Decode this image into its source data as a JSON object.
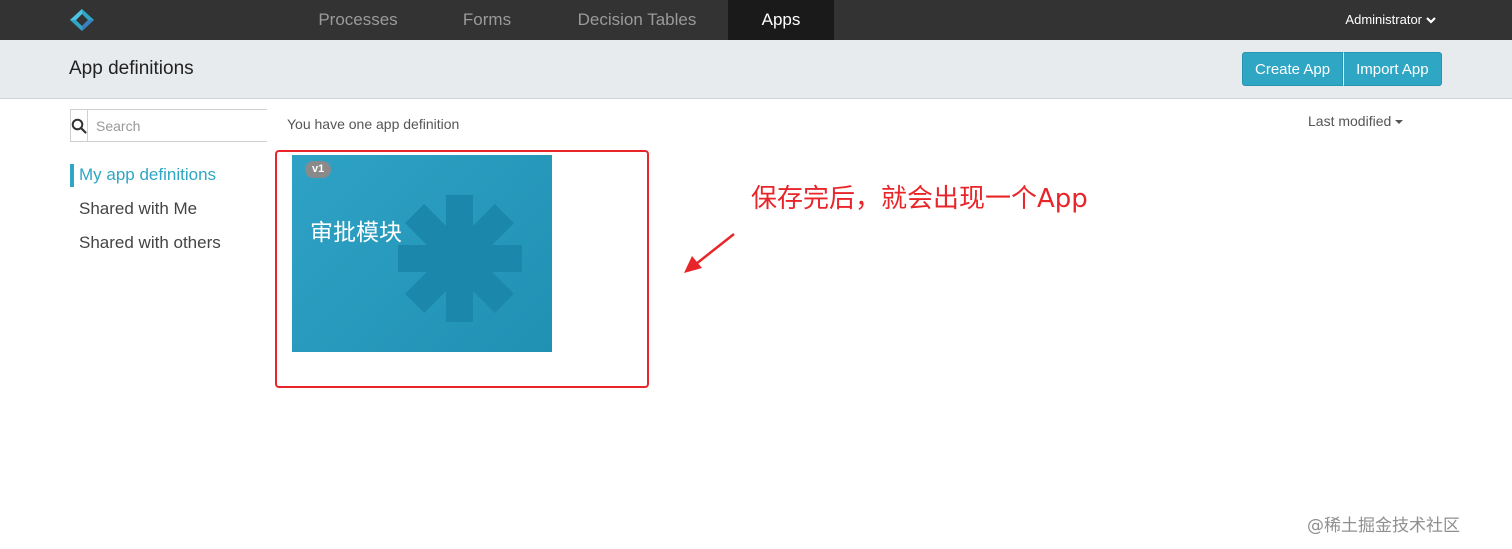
{
  "nav": {
    "items": [
      {
        "label": "Processes"
      },
      {
        "label": "Forms"
      },
      {
        "label": "Decision Tables"
      },
      {
        "label": "Apps"
      }
    ],
    "user": "Administrator"
  },
  "header": {
    "title": "App definitions",
    "create_label": "Create App",
    "import_label": "Import App"
  },
  "search": {
    "placeholder": "Search",
    "value": ""
  },
  "sidebar": {
    "items": [
      {
        "label": "My app definitions"
      },
      {
        "label": "Shared with Me"
      },
      {
        "label": "Shared with others"
      }
    ]
  },
  "main": {
    "summary": "You have one app definition",
    "sort_label": "Last modified",
    "apps": [
      {
        "version": "v1",
        "name": "审批模块"
      }
    ]
  },
  "annotation": {
    "text": "保存完后，就会出现一个App",
    "color": "#e8262a"
  },
  "watermark": "@稀土掘金技术社区",
  "colors": {
    "accent": "#2fa6c3",
    "topbar": "#333333",
    "card": "#239dc2"
  }
}
